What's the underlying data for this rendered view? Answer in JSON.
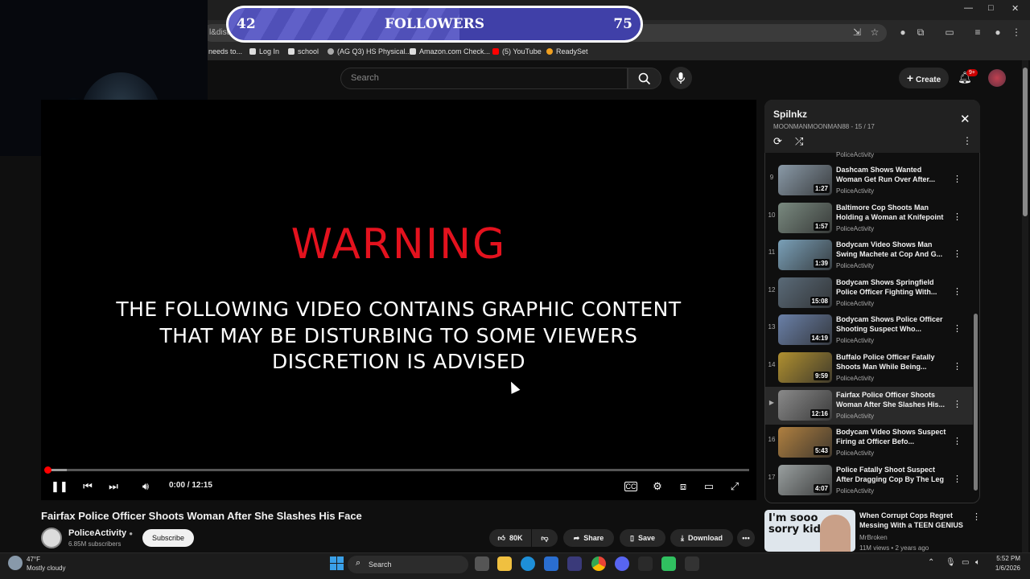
{
  "browser": {
    "url_fragment": "l&dist",
    "bookmarks": [
      {
        "label": "needs to...",
        "color": "#666666"
      },
      {
        "label": "Log In",
        "color": "#dddddd"
      },
      {
        "label": "school",
        "color": "#dddddd"
      },
      {
        "label": "(AG Q3) HS Physical...",
        "color": "#aaaaaa"
      },
      {
        "label": "Amazon.com Check...",
        "color": "#dddddd"
      },
      {
        "label": "(5) YouTube",
        "color": "#ff0000"
      },
      {
        "label": "ReadySet",
        "color": "#f0a020"
      }
    ]
  },
  "overlay": {
    "followers_current": "42",
    "followers_label": "FOLLOWERS",
    "followers_goal": "75",
    "progress_fraction": 0.56
  },
  "header": {
    "search_placeholder": "Search",
    "create_label": "Create",
    "notification_badge": "9+"
  },
  "player": {
    "warning_title": "WARNING",
    "warning_lines": [
      "THE FOLLOWING VIDEO CONTAINS GRAPHIC CONTENT",
      "THAT MAY BE DISTURBING TO SOME VIEWERS",
      "DISCRETION IS ADVISED"
    ],
    "time": "0:00 / 12:15"
  },
  "video": {
    "title": "Fairfax Police Officer Shoots Woman After She Slashes His Face",
    "channel": "PoliceActivity",
    "subscribers": "6.85M subscribers",
    "subscribe_label": "Subscribe",
    "likes": "80K",
    "share_label": "Share",
    "save_label": "Save",
    "download_label": "Download"
  },
  "playlist": {
    "title": "Spilnkz",
    "subtitle": "MOONMANMOONMAN88 - 15 / 17",
    "partial_channel": "PoliceActivity",
    "items": [
      {
        "num": "9",
        "title": "Dashcam Shows Wanted Woman Get Run Over After...",
        "channel": "PoliceActivity",
        "duration": "1:27",
        "color": "#8a9aa8"
      },
      {
        "num": "10",
        "title": "Baltimore Cop Shoots Man Holding a Woman at Knifepoint",
        "channel": "PoliceActivity",
        "duration": "1:57",
        "color": "#7a8a80"
      },
      {
        "num": "11",
        "title": "Bodycam Video Shows Man Swing Machete at Cop And G...",
        "channel": "PoliceActivity",
        "duration": "1:39",
        "color": "#7aa0b8"
      },
      {
        "num": "12",
        "title": "Bodycam Shows Springfield Police Officer Fighting With...",
        "channel": "PoliceActivity",
        "duration": "15:08",
        "color": "#5a6a78"
      },
      {
        "num": "13",
        "title": "Bodycam Shows Police Officer Shooting Suspect Who...",
        "channel": "PoliceActivity",
        "duration": "14:19",
        "color": "#6a80a8"
      },
      {
        "num": "14",
        "title": "Buffalo Police Officer Fatally Shoots Man While Being...",
        "channel": "PoliceActivity",
        "duration": "9:59",
        "color": "#b09030"
      },
      {
        "num": "▶",
        "title": "Fairfax Police Officer Shoots Woman After She Slashes His...",
        "channel": "PoliceActivity",
        "duration": "12:16",
        "color": "#8a8a8a"
      },
      {
        "num": "16",
        "title": "Bodycam Video Shows Suspect Firing at Officer Befo...",
        "channel": "PoliceActivity",
        "duration": "5:43",
        "color": "#b08040"
      },
      {
        "num": "17",
        "title": "Police Fatally Shoot Suspect After Dragging Cop By The Leg",
        "channel": "PoliceActivity",
        "duration": "4:07",
        "color": "#9aa0a0"
      }
    ]
  },
  "recommended": {
    "thumb_text_1": "I'm sooo",
    "thumb_text_2": "sorry kid",
    "title": "When Corrupt Cops Regret Messing With a TEEN GENIUS",
    "channel": "MrBroken",
    "meta": "11M views • 2 years ago"
  },
  "taskbar": {
    "temperature": "47°F",
    "weather": "Mostly cloudy",
    "search_label": "Search",
    "time": "5:52 PM",
    "date": "1/6/2026"
  }
}
